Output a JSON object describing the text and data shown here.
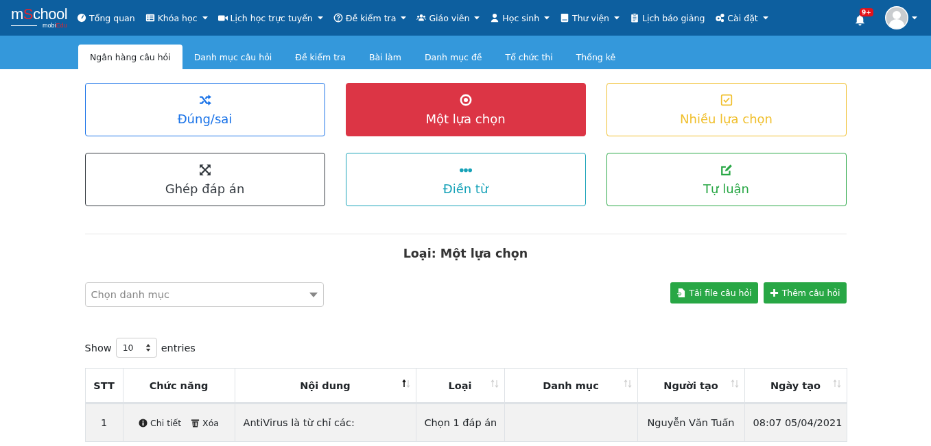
{
  "logo": {
    "name": [
      "m",
      "S",
      "chool"
    ],
    "tagline": [
      "mobi",
      "Edu"
    ]
  },
  "nav": [
    {
      "kind": "gauge",
      "label": "Tổng quan",
      "dropdown": false
    },
    {
      "kind": "list",
      "label": "Khóa học",
      "dropdown": true
    },
    {
      "kind": "video",
      "label": "Lịch học trực tuyến",
      "dropdown": true
    },
    {
      "kind": "question",
      "label": "Đề kiểm tra",
      "dropdown": true
    },
    {
      "kind": "users",
      "label": "Giáo viên",
      "dropdown": true
    },
    {
      "kind": "user",
      "label": "Học sinh",
      "dropdown": true
    },
    {
      "kind": "book",
      "label": "Thư viện",
      "dropdown": true
    },
    {
      "kind": "clipboard",
      "label": "Lịch báo giảng",
      "dropdown": false
    },
    {
      "kind": "cogs",
      "label": "Cài đặt",
      "dropdown": true
    }
  ],
  "notifications": {
    "badge": "9+"
  },
  "tabs": [
    {
      "label": "Ngân hàng câu hỏi",
      "selected": true
    },
    {
      "label": "Danh mục câu hỏi",
      "selected": false
    },
    {
      "label": "Đề kiểm tra",
      "selected": false
    },
    {
      "label": "Bài làm",
      "selected": false
    },
    {
      "label": "Danh mục đề",
      "selected": false
    },
    {
      "label": "Tổ chức thi",
      "selected": false
    },
    {
      "label": "Thống kê",
      "selected": false
    }
  ],
  "types": [
    {
      "kind": "shuffle",
      "label": "Đúng/sai",
      "color": "#1a73e8",
      "selected": false
    },
    {
      "kind": "radio",
      "label": "Một lựa chọn",
      "color": "#dc3545",
      "selected": true
    },
    {
      "kind": "checkbox",
      "label": "Nhiều lựa chọn",
      "color": "#f0bf2c",
      "selected": false
    },
    {
      "kind": "expand",
      "label": "Ghép đáp án",
      "color": "#343a40",
      "selected": false
    },
    {
      "kind": "dots",
      "label": "Điền từ",
      "color": "#17a2b8",
      "selected": false
    },
    {
      "kind": "edit",
      "label": "Tự luận",
      "color": "#28a745",
      "selected": false
    }
  ],
  "type_heading": "Loại: Một lựa chọn",
  "category_select": {
    "placeholder": "Chọn danh mục"
  },
  "actions": [
    {
      "kind": "upload",
      "label": "Tải file câu hỏi"
    },
    {
      "kind": "add",
      "label": "Thêm câu hỏi"
    }
  ],
  "length": {
    "before": "Show",
    "value": "10",
    "after": "entries"
  },
  "table": {
    "columns": [
      {
        "label": "STT",
        "sortable": false,
        "sorted": false
      },
      {
        "label": "Chức năng",
        "sortable": false,
        "sorted": false
      },
      {
        "label": "Nội dung",
        "sortable": true,
        "sorted": true
      },
      {
        "label": "Loại",
        "sortable": true,
        "sorted": false
      },
      {
        "label": "Danh mục",
        "sortable": true,
        "sorted": false
      },
      {
        "label": "Người tạo",
        "sortable": true,
        "sorted": false
      },
      {
        "label": "Ngày tạo",
        "sortable": true,
        "sorted": false
      }
    ],
    "rows": [
      {
        "stt": "1",
        "actions": [
          {
            "kind": "detail",
            "label": "Chi tiết"
          },
          {
            "kind": "delete",
            "label": "Xóa"
          }
        ],
        "content": "AntiVirus là từ chỉ các:",
        "type": "Chọn 1 đáp án",
        "creator": "Nguyễn Văn Tuấn",
        "created": "08:07 05/04/2021"
      }
    ]
  }
}
